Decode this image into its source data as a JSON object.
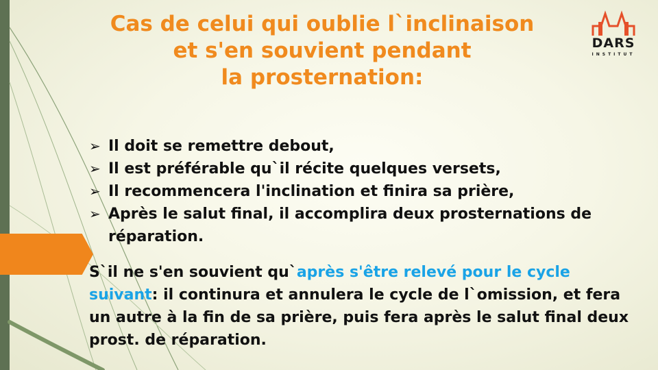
{
  "title": {
    "lines": [
      "Cas de celui qui oublie l`inclinaison",
      "et s'en souvient pendant",
      "la prosternation:"
    ]
  },
  "logo": {
    "text": "DARS",
    "subtext": "INSTITUT"
  },
  "bullets": [
    {
      "text": "Il doit se remettre debout,"
    },
    {
      "text": "Il est préférable qu`il récite quelques versets,"
    },
    {
      "text": "Il recommencera l'inclination et finira sa prière,"
    },
    {
      "text": "Après le salut final, il accomplira deux prosternations de réparation."
    }
  ],
  "paragraph": {
    "part1": "S`il ne s'en souvient qu`",
    "highlight": "après s'être relevé pour le cycle suivant",
    "part2": ": il continura et annulera le cycle de l`omission, et fera un autre à la fin de sa prière, puis fera après le salut final deux prost. de réparation."
  },
  "colors": {
    "title": "#f08a1e",
    "highlight": "#1aa3e6",
    "left_bar": "#5e7153",
    "orange_arrow": "#f0861c",
    "logo_accent": "#e5502a"
  }
}
